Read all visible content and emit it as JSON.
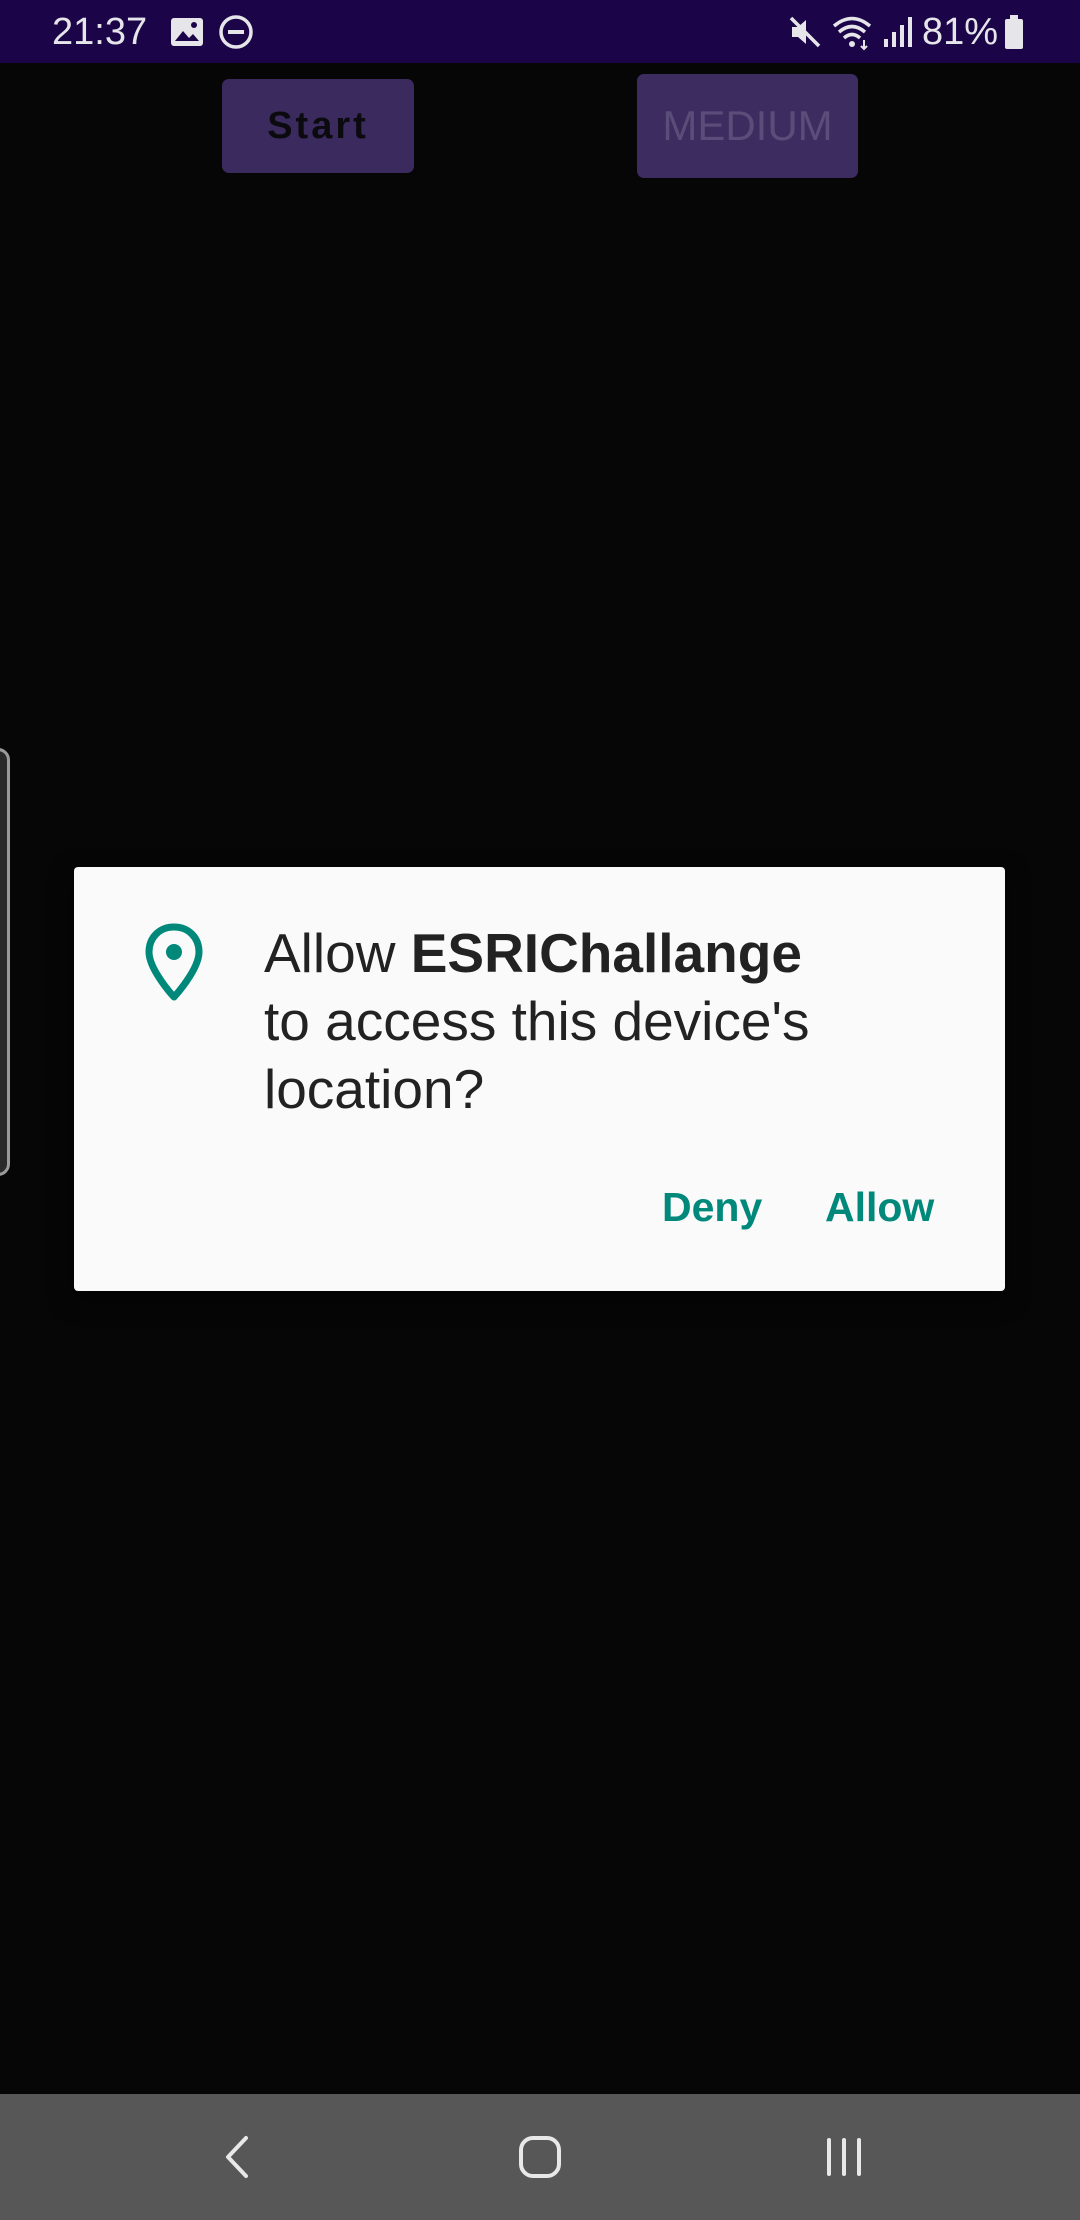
{
  "status_bar": {
    "time": "21:37",
    "battery_percent": "81%",
    "icons": [
      "image-icon",
      "do-not-disturb-icon",
      "mute-icon",
      "wifi-icon",
      "signal-icon",
      "battery-icon"
    ],
    "background": "#1b0548"
  },
  "toolbar": {
    "start_label": "Start",
    "difficulty_label": "MEDIUM"
  },
  "dialog": {
    "icon": "location-pin-icon",
    "message_prefix": "Allow ",
    "app_name": "ESRIChallange",
    "message_suffix": "to access this device's location?",
    "deny_label": "Deny",
    "allow_label": "Allow",
    "accent_color": "#00897b"
  },
  "nav_bar": {
    "icons": [
      "back-icon",
      "home-icon",
      "recents-icon"
    ],
    "background": "#575757"
  }
}
